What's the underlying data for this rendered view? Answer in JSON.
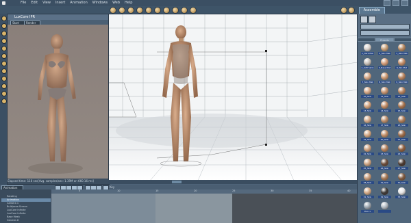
{
  "menubar": {
    "items": [
      "File",
      "Edit",
      "View",
      "Insert",
      "Animation",
      "Windows",
      "Web",
      "Help"
    ]
  },
  "toolbar": {
    "workspace_tab": "Assemble"
  },
  "ipr_panel": {
    "title": "LuxCore IPR",
    "dropdown_left": "Start",
    "dropdown_right": "Render",
    "status": "Elapsed time: 116 sec[Avg. samples/sec: 1.39M on 660.16 ms]"
  },
  "right_panel": {
    "tabs": [
      "",
      "Presets",
      ""
    ],
    "materials": [
      {
        "label": "1_Dark Mat",
        "color": "#d9d2cc"
      },
      {
        "label": "2_Skin Mat",
        "color": "#caa27a"
      },
      {
        "label": "3_Skin Mat",
        "color": "#b98b63"
      },
      {
        "label": "4_Soft Satin",
        "color": "#c8c1ba"
      },
      {
        "label": "5_Base Mat",
        "color": "#d59e7b"
      },
      {
        "label": "6_Tan Mat",
        "color": "#c58f6a"
      },
      {
        "label": "7_Skin Mat",
        "color": "#d6a887"
      },
      {
        "label": "8_Skin Mat",
        "color": "#cd9a73"
      },
      {
        "label": "9_Skin Mat",
        "color": "#b98560"
      },
      {
        "label": "10_Skin",
        "color": "#d7aa89"
      },
      {
        "label": "11_Skin",
        "color": "#c99673"
      },
      {
        "label": "12_Skin",
        "color": "#b8845f"
      },
      {
        "label": "13_Skin",
        "color": "#d3a47f"
      },
      {
        "label": "14_Skin",
        "color": "#c18d67"
      },
      {
        "label": "15_Skin",
        "color": "#a8754f"
      },
      {
        "label": "16_Skin",
        "color": "#d4ab8c"
      },
      {
        "label": "17_Skin",
        "color": "#be906d"
      },
      {
        "label": "18_Skin",
        "color": "#af7e5a"
      },
      {
        "label": "19_Skin",
        "color": "#d5a984"
      },
      {
        "label": "20_Skin",
        "color": "#c39069"
      },
      {
        "label": "21_Skin",
        "color": "#9e6d4a"
      },
      {
        "label": "22_Skin",
        "color": "#cda180"
      },
      {
        "label": "23_Skin",
        "color": "#b48461"
      },
      {
        "label": "24_Skin",
        "color": "#8f6040"
      },
      {
        "label": "25_Skin",
        "color": "#d0a684"
      },
      {
        "label": "26_Skin",
        "color": "#6a4c3b"
      },
      {
        "label": "27_Skin",
        "color": "#4a3a32"
      },
      {
        "label": "28_Skin",
        "color": "#c69c7a"
      },
      {
        "label": "29_Skin",
        "color": "#a77a57"
      },
      {
        "label": "30_Skin",
        "color": "#7f5b41"
      },
      {
        "label": "31_Skin",
        "color": "#d4ab88"
      },
      {
        "label": "32_Skin",
        "color": "#3d3a38"
      },
      {
        "label": "33_Skin",
        "color": "#e7e7e7"
      },
      {
        "label": "Pool 1",
        "color": "#9da8b2"
      },
      {
        "label": "",
        "color": "#b3bcc4"
      }
    ]
  },
  "timeline": {
    "mode_dropdown": "Animation",
    "key_label": "Key",
    "ticks": [
      "5",
      "10",
      "15",
      "20",
      "25",
      "30",
      "35",
      "40"
    ],
    "tracks": [
      "Rotating",
      "Animation",
      "Camera 1",
      "Bulb/area Screen",
      "LuxCore Infinite",
      "LuxCore Infinite",
      "Base Mesh",
      "Genesis 8"
    ]
  }
}
